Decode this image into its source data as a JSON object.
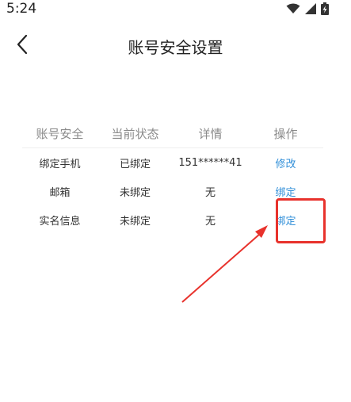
{
  "status_bar": {
    "time": "5:24",
    "icons": [
      "wifi-icon",
      "signal-icon",
      "battery-charging-icon"
    ]
  },
  "header": {
    "back_icon": "chevron-left-icon",
    "title": "账号安全设置"
  },
  "table": {
    "headers": [
      "账号安全",
      "当前状态",
      "详情",
      "操作"
    ],
    "rows": [
      {
        "item": "绑定手机",
        "status": "已绑定",
        "detail": "151******41",
        "action": "修改"
      },
      {
        "item": "邮箱",
        "status": "未绑定",
        "detail": "无",
        "action": "绑定"
      },
      {
        "item": "实名信息",
        "status": "未绑定",
        "detail": "无",
        "action": "绑定"
      }
    ]
  },
  "annotation": {
    "color": "#e8322c"
  },
  "colors": {
    "link": "#2f8ed8",
    "header_text": "#8a8a8a"
  }
}
